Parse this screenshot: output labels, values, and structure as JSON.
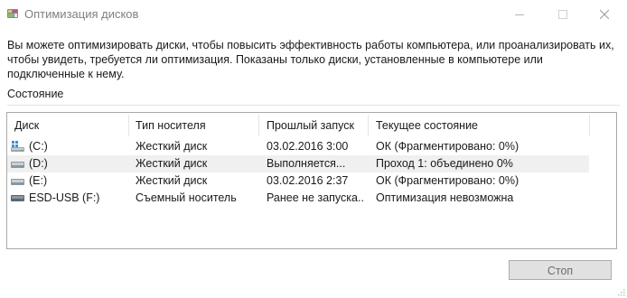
{
  "window": {
    "title": "Оптимизация дисков",
    "icon": "defrag-app-icon",
    "controls": [
      "minimize-icon",
      "maximize-icon",
      "close-icon"
    ]
  },
  "description": "Вы можете оптимизировать диски, чтобы повысить эффективность работы  компьютера, или проанализировать их, чтобы увидеть, требуется ли оптимизация. Показаны только диски, установленные в компьютере или подключенные к нему.",
  "status": {
    "label": "Состояние"
  },
  "table": {
    "columns": [
      "Диск",
      "Тип носителя",
      "Прошлый запуск",
      "Текущее состояние"
    ],
    "rows": [
      {
        "icon": "system-drive-icon",
        "drive": "(C:)",
        "media": "Жесткий диск",
        "last_run": "03.02.2016 3:00",
        "status": "ОК (Фрагментировано: 0%)",
        "selected": false
      },
      {
        "icon": "hard-drive-icon",
        "drive": "(D:)",
        "media": "Жесткий диск",
        "last_run": "Выполняется...",
        "status": "Проход 1: объединено 0%",
        "selected": true
      },
      {
        "icon": "hard-drive-icon",
        "drive": "(E:)",
        "media": "Жесткий диск",
        "last_run": "03.02.2016 2:37",
        "status": "ОК (Фрагментировано: 0%)",
        "selected": false
      },
      {
        "icon": "usb-drive-icon",
        "drive": "ESD-USB (F:)",
        "media": "Съемный носитель",
        "last_run": "Ранее не запуска...",
        "status": "Оптимизация невозможна",
        "selected": false
      }
    ]
  },
  "buttons": {
    "stop": "Стоп"
  },
  "colors": {
    "selected_row": "#f0f0f0",
    "border": "#a9a9a9",
    "button_bg": "#e1e1e1",
    "title_text": "#808080"
  }
}
